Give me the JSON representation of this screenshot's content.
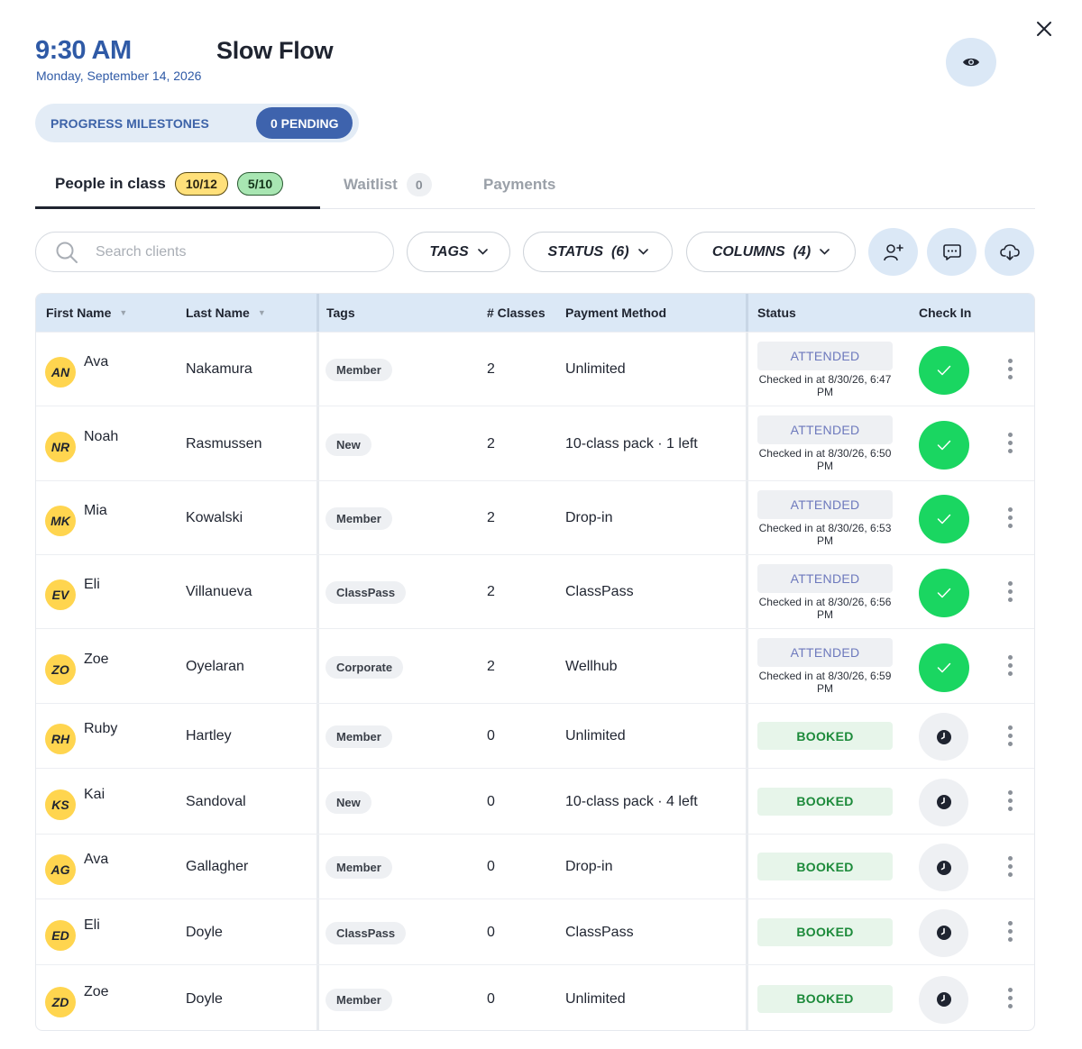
{
  "header": {
    "time": "9:30 AM",
    "date": "Monday, September 14, 2026",
    "title": "Slow Flow"
  },
  "milestones": {
    "label": "PROGRESS MILESTONES",
    "pending": "0 PENDING"
  },
  "tabs": {
    "people": {
      "label": "People in class",
      "badge_capacity": "10/12",
      "badge_checked": "5/10"
    },
    "waitlist": {
      "label": "Waitlist",
      "badge": "0"
    },
    "payments": {
      "label": "Payments"
    }
  },
  "toolbar": {
    "search_placeholder": "Search clients",
    "tags_label": "TAGS",
    "status_label": "STATUS  (6)",
    "columns_label": "COLUMNS  (4)"
  },
  "table": {
    "headers": {
      "first_name": "First Name",
      "last_name": "Last Name",
      "tags": "Tags",
      "classes": "# Classes",
      "payment": "Payment Method",
      "status": "Status",
      "checkin": "Check In"
    },
    "rows": [
      {
        "initials": "AN",
        "first": "Ava",
        "last": "Nakamura",
        "tag": "Member",
        "classes": "2",
        "payment": "Unlimited",
        "status": "ATTENDED",
        "note": "Checked in at 8/30/26, 6:47 PM"
      },
      {
        "initials": "NR",
        "first": "Noah",
        "last": "Rasmussen",
        "tag": "New",
        "classes": "2",
        "payment": "10-class pack · 1 left",
        "status": "ATTENDED",
        "note": "Checked in at 8/30/26, 6:50 PM"
      },
      {
        "initials": "MK",
        "first": "Mia",
        "last": "Kowalski",
        "tag": "Member",
        "classes": "2",
        "payment": "Drop-in",
        "status": "ATTENDED",
        "note": "Checked in at 8/30/26, 6:53 PM"
      },
      {
        "initials": "EV",
        "first": "Eli",
        "last": "Villanueva",
        "tag": "ClassPass",
        "classes": "2",
        "payment": "ClassPass",
        "status": "ATTENDED",
        "note": "Checked in at 8/30/26, 6:56 PM"
      },
      {
        "initials": "ZO",
        "first": "Zoe",
        "last": "Oyelaran",
        "tag": "Corporate",
        "classes": "2",
        "payment": "Wellhub",
        "status": "ATTENDED",
        "note": "Checked in at 8/30/26, 6:59 PM"
      },
      {
        "initials": "RH",
        "first": "Ruby",
        "last": "Hartley",
        "tag": "Member",
        "classes": "0",
        "payment": "Unlimited",
        "status": "BOOKED",
        "note": ""
      },
      {
        "initials": "KS",
        "first": "Kai",
        "last": "Sandoval",
        "tag": "New",
        "classes": "0",
        "payment": "10-class pack · 4 left",
        "status": "BOOKED",
        "note": ""
      },
      {
        "initials": "AG",
        "first": "Ava",
        "last": "Gallagher",
        "tag": "Member",
        "classes": "0",
        "payment": "Drop-in",
        "status": "BOOKED",
        "note": ""
      },
      {
        "initials": "ED",
        "first": "Eli",
        "last": "Doyle",
        "tag": "ClassPass",
        "classes": "0",
        "payment": "ClassPass",
        "status": "BOOKED",
        "note": ""
      },
      {
        "initials": "ZD",
        "first": "Zoe",
        "last": "Doyle",
        "tag": "Member",
        "classes": "0",
        "payment": "Unlimited",
        "status": "BOOKED",
        "note": ""
      }
    ]
  },
  "colors": {
    "accent_blue": "#2f5aa6",
    "pill_blue": "#3e63ad",
    "soft_blue": "#dbe8f6",
    "check_green": "#1ad661",
    "booked_green": "#1c8a3a",
    "avatar_yellow": "#ffd54f"
  },
  "icons": {
    "close": "close-icon",
    "eye": "eye-icon",
    "search": "search-icon",
    "add_user": "add-user-icon",
    "message": "message-icon",
    "download": "cloud-download-icon",
    "check": "check-icon",
    "clock": "clock-icon",
    "more": "more-vertical-icon"
  }
}
